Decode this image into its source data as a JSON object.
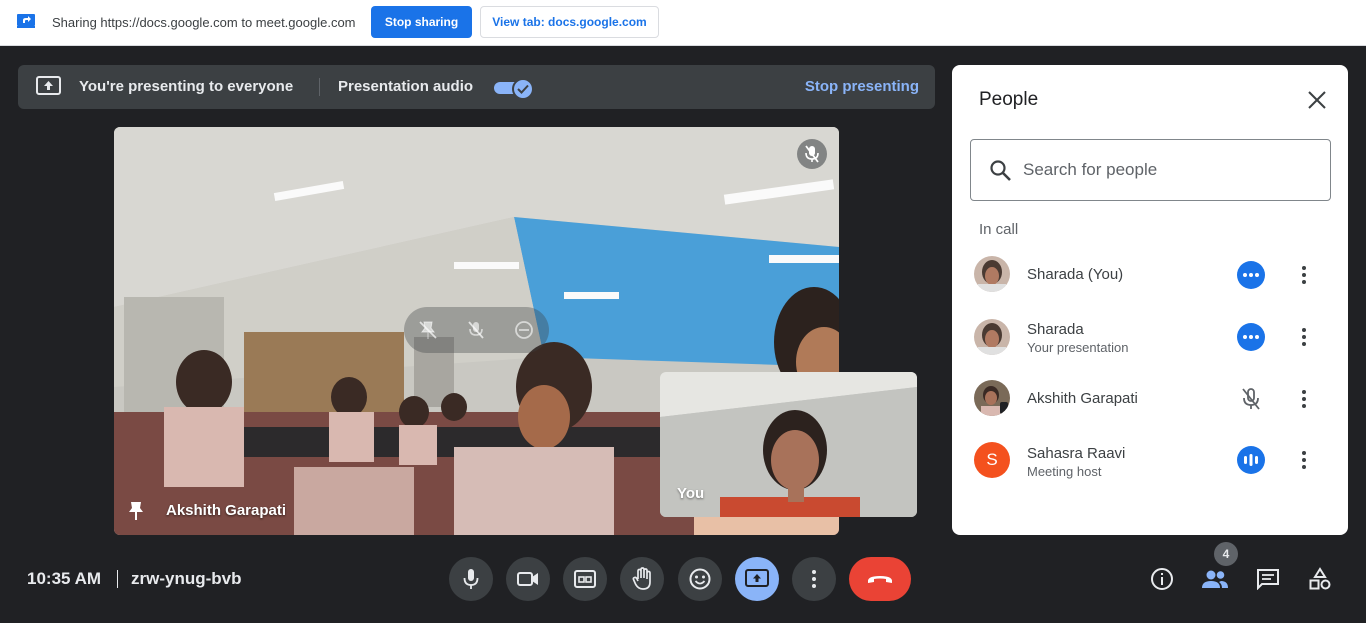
{
  "sharing_bar": {
    "text": "Sharing https://docs.google.com to meet.google.com",
    "stop_sharing": "Stop sharing",
    "view_tab": "View tab: docs.google.com"
  },
  "banner": {
    "presenting_text": "You're presenting to everyone",
    "audio_label": "Presentation audio",
    "audio_enabled": true,
    "stop_presenting": "Stop presenting"
  },
  "main_tile": {
    "name": "Akshith Garapati",
    "muted": true
  },
  "self_tile": {
    "label": "You"
  },
  "people_panel": {
    "title": "People",
    "search_placeholder": "Search for people",
    "section_label": "In call",
    "people": [
      {
        "name": "Sharada (You)",
        "subtitle": "",
        "status": "more-options",
        "avatar": "photo"
      },
      {
        "name": "Sharada",
        "subtitle": "Your presentation",
        "status": "more-options",
        "avatar": "photo"
      },
      {
        "name": "Akshith Garapati",
        "subtitle": "",
        "status": "muted",
        "avatar": "photo"
      },
      {
        "name": "Sahasra Raavi",
        "subtitle": "Meeting host",
        "status": "speaking",
        "avatar": "S",
        "avatar_color": "#f4511e"
      }
    ]
  },
  "bottom_bar": {
    "time": "10:35 AM",
    "meeting_code": "zrw-ynug-bvb",
    "controls": [
      "microphone-icon",
      "camera-icon",
      "captions-icon",
      "raise-hand-icon",
      "emoji-icon",
      "present-icon",
      "more-options-icon",
      "end-call-icon"
    ],
    "right_controls": [
      "info-icon",
      "people-icon",
      "chat-icon",
      "activities-icon"
    ],
    "people_count": "4"
  },
  "colors": {
    "accent": "#1a73e8",
    "light_accent": "#8ab4f8",
    "end_call": "#ea4335",
    "background": "#202124"
  }
}
